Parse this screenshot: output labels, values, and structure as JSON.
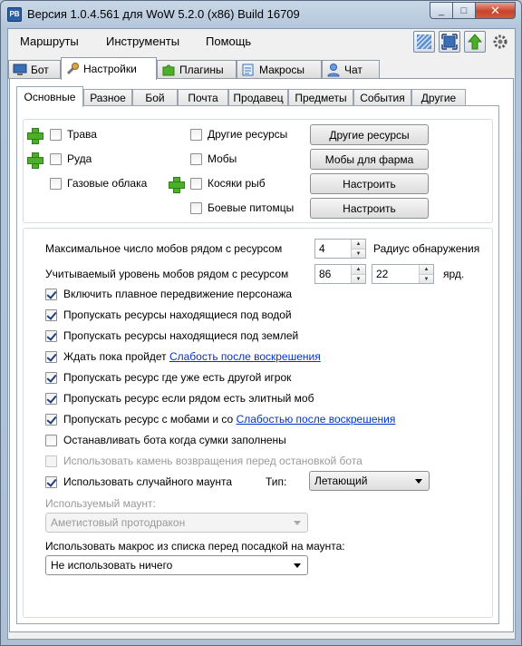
{
  "window": {
    "title": "Версия 1.0.4.561 для WoW 5.2.0 (x86) Build 16709",
    "app_icon_text": "PB",
    "close_glyph": "✕",
    "max_glyph": "□",
    "min_glyph": "_"
  },
  "menu": {
    "items": [
      "Маршруты",
      "Инструменты",
      "Помощь"
    ]
  },
  "main_tabs": [
    "Бот",
    "Настройки",
    "Плагины",
    "Макросы",
    "Чат"
  ],
  "sub_tabs": [
    "Основные",
    "Разное",
    "Бой",
    "Почта",
    "Продавец",
    "Предметы",
    "События",
    "Другие"
  ],
  "resources": {
    "herbs": "Трава",
    "ore": "Руда",
    "gas": "Газовые облака",
    "other": "Другие ресурсы",
    "mobs": "Мобы",
    "fish": "Косяки рыб",
    "pets": "Боевые питомцы",
    "btn_other": "Другие ресурсы",
    "btn_mobs": "Мобы для фарма",
    "btn_fish": "Настроить",
    "btn_pets": "Настроить"
  },
  "settings": {
    "max_mobs_label": "Максимальное число мобов рядом с ресурсом",
    "max_mobs_value": "4",
    "detect_radius_label": "Радиус обнаружения",
    "mob_level_label": "Учитываемый уровень мобов рядом с ресурсом",
    "mob_level_value": "86",
    "radius_value": "22",
    "yards": "ярд.",
    "smooth_move": "Включить плавное передвижение персонажа",
    "skip_underwater": "Пропускать ресурсы находящиеся под водой",
    "skip_underground": "Пропускать ресурсы находящиеся под землей",
    "wait_prefix": "Ждать пока пройдет ",
    "wait_link": "Слабость после воскрешения",
    "skip_player": "Пропускать ресурс где уже есть другой игрок",
    "skip_elite": "Пропускать ресурс если рядом есть элитный моб",
    "skip_mobs_prefix": "Пропускать ресурс с мобами и со ",
    "skip_mobs_link": "Слабостью после воскрешения",
    "stop_bags": "Останавливать бота когда сумки заполнены",
    "hearthstone": "Использовать камень возвращения перед остановкой бота",
    "random_mount": "Использовать случайного маунта",
    "type_label": "Тип:",
    "type_value": "Летающий",
    "used_mount_label": "Используемый маунт:",
    "used_mount_value": "Аметистовый протодракон",
    "macro_label": "Использовать макрос из списка перед посадкой на маунта:",
    "macro_value": "Не использовать ничего"
  }
}
